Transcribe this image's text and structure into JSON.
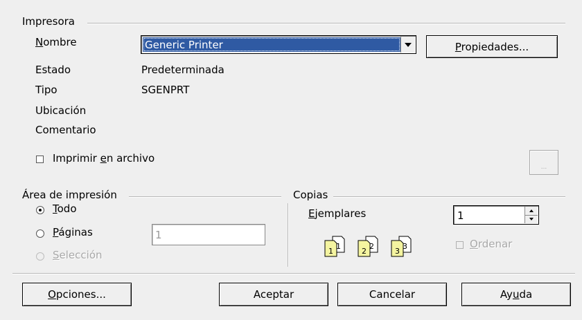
{
  "printer": {
    "group_title": "Impresora",
    "name_label": "Nombre",
    "name_value": "Generic Printer",
    "properties_button": "Propiedades...",
    "status_label": "Estado",
    "status_value": "Predeterminada",
    "type_label": "Tipo",
    "type_value": "SGENPRT",
    "location_label": "Ubicación",
    "comment_label": "Comentario",
    "print_to_file_label": "Imprimir en archivo",
    "browse_button": "..."
  },
  "print_area": {
    "group_title": "Área de impresión",
    "all_label": "Todo",
    "pages_label": "Páginas",
    "pages_value": "1",
    "selection_label": "Selección"
  },
  "copies": {
    "group_title": "Copias",
    "count_label": "Ejemplares",
    "count_value": "1",
    "collate_label": "Ordenar"
  },
  "buttons": {
    "options": "Opciones...",
    "ok": "Aceptar",
    "cancel": "Cancelar",
    "help": "Ayuda"
  }
}
